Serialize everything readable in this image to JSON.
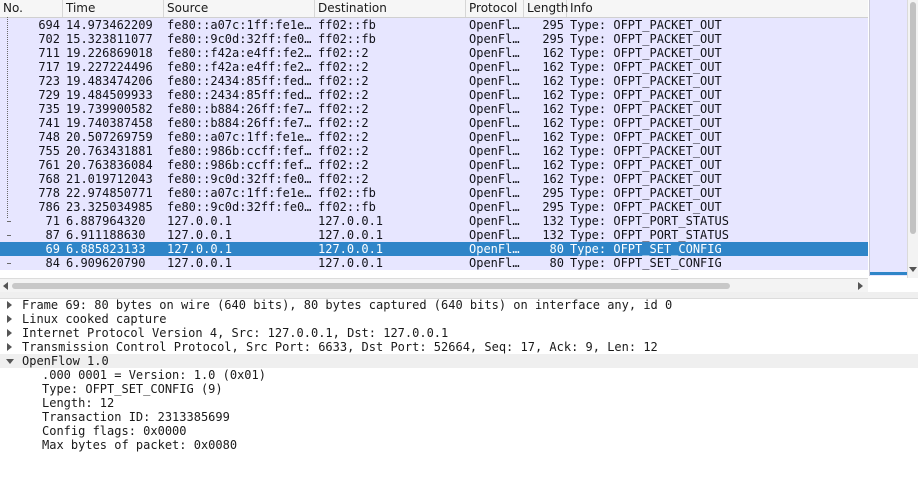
{
  "columns": {
    "no": "No.",
    "time": "Time",
    "source": "Source",
    "destination": "Destination",
    "protocol": "Protocol",
    "length": "Length",
    "info": "Info"
  },
  "packets": [
    {
      "no": "694",
      "time": "14.973462209",
      "source": "fe80::a07c:1ff:fe1e…",
      "destination": "ff02::fb",
      "protocol": "OpenFl…",
      "length": "295",
      "info": "Type: OFPT_PACKET_OUT",
      "selected": false
    },
    {
      "no": "702",
      "time": "15.323811077",
      "source": "fe80::9c0d:32ff:fe0…",
      "destination": "ff02::fb",
      "protocol": "OpenFl…",
      "length": "295",
      "info": "Type: OFPT_PACKET_OUT",
      "selected": false
    },
    {
      "no": "711",
      "time": "19.226869018",
      "source": "fe80::f42a:e4ff:fe2…",
      "destination": "ff02::2",
      "protocol": "OpenFl…",
      "length": "162",
      "info": "Type: OFPT_PACKET_OUT",
      "selected": false
    },
    {
      "no": "717",
      "time": "19.227224496",
      "source": "fe80::f42a:e4ff:fe2…",
      "destination": "ff02::2",
      "protocol": "OpenFl…",
      "length": "162",
      "info": "Type: OFPT_PACKET_OUT",
      "selected": false
    },
    {
      "no": "723",
      "time": "19.483474206",
      "source": "fe80::2434:85ff:fed…",
      "destination": "ff02::2",
      "protocol": "OpenFl…",
      "length": "162",
      "info": "Type: OFPT_PACKET_OUT",
      "selected": false
    },
    {
      "no": "729",
      "time": "19.484509933",
      "source": "fe80::2434:85ff:fed…",
      "destination": "ff02::2",
      "protocol": "OpenFl…",
      "length": "162",
      "info": "Type: OFPT_PACKET_OUT",
      "selected": false
    },
    {
      "no": "735",
      "time": "19.739900582",
      "source": "fe80::b884:26ff:fe7…",
      "destination": "ff02::2",
      "protocol": "OpenFl…",
      "length": "162",
      "info": "Type: OFPT_PACKET_OUT",
      "selected": false
    },
    {
      "no": "741",
      "time": "19.740387458",
      "source": "fe80::b884:26ff:fe7…",
      "destination": "ff02::2",
      "protocol": "OpenFl…",
      "length": "162",
      "info": "Type: OFPT_PACKET_OUT",
      "selected": false
    },
    {
      "no": "748",
      "time": "20.507269759",
      "source": "fe80::a07c:1ff:fe1e…",
      "destination": "ff02::2",
      "protocol": "OpenFl…",
      "length": "162",
      "info": "Type: OFPT_PACKET_OUT",
      "selected": false
    },
    {
      "no": "755",
      "time": "20.763431881",
      "source": "fe80::986b:ccff:fef…",
      "destination": "ff02::2",
      "protocol": "OpenFl…",
      "length": "162",
      "info": "Type: OFPT_PACKET_OUT",
      "selected": false
    },
    {
      "no": "761",
      "time": "20.763836084",
      "source": "fe80::986b:ccff:fef…",
      "destination": "ff02::2",
      "protocol": "OpenFl…",
      "length": "162",
      "info": "Type: OFPT_PACKET_OUT",
      "selected": false
    },
    {
      "no": "768",
      "time": "21.019712043",
      "source": "fe80::9c0d:32ff:fe0…",
      "destination": "ff02::2",
      "protocol": "OpenFl…",
      "length": "162",
      "info": "Type: OFPT_PACKET_OUT",
      "selected": false
    },
    {
      "no": "778",
      "time": "22.974850771",
      "source": "fe80::a07c:1ff:fe1e…",
      "destination": "ff02::fb",
      "protocol": "OpenFl…",
      "length": "295",
      "info": "Type: OFPT_PACKET_OUT",
      "selected": false
    },
    {
      "no": "786",
      "time": "23.325034985",
      "source": "fe80::9c0d:32ff:fe0…",
      "destination": "ff02::fb",
      "protocol": "OpenFl…",
      "length": "295",
      "info": "Type: OFPT_PACKET_OUT",
      "selected": false
    },
    {
      "no": "71",
      "time": "6.887964320",
      "source": "127.0.0.1",
      "destination": "127.0.0.1",
      "protocol": "OpenFl…",
      "length": "132",
      "info": "Type: OFPT_PORT_STATUS",
      "selected": false
    },
    {
      "no": "87",
      "time": "6.911188630",
      "source": "127.0.0.1",
      "destination": "127.0.0.1",
      "protocol": "OpenFl…",
      "length": "132",
      "info": "Type: OFPT_PORT_STATUS",
      "selected": false
    },
    {
      "no": "69",
      "time": "6.885823133",
      "source": "127.0.0.1",
      "destination": "127.0.0.1",
      "protocol": "OpenFl…",
      "length": "80",
      "info": "Type: OFPT_SET_CONFIG",
      "selected": true
    },
    {
      "no": "84",
      "time": "6.909620790",
      "source": "127.0.0.1",
      "destination": "127.0.0.1",
      "protocol": "OpenFl…",
      "length": "80",
      "info": "Type: OFPT_SET_CONFIG",
      "selected": false
    }
  ],
  "details": [
    {
      "text": "Frame 69: 80 bytes on wire (640 bits), 80 bytes captured (640 bits) on interface any, id 0",
      "state": "closed"
    },
    {
      "text": "Linux cooked capture",
      "state": "closed"
    },
    {
      "text": "Internet Protocol Version 4, Src: 127.0.0.1, Dst: 127.0.0.1",
      "state": "closed"
    },
    {
      "text": "Transmission Control Protocol, Src Port: 6633, Dst Port: 52664, Seq: 17, Ack: 9, Len: 12",
      "state": "closed"
    },
    {
      "text": "OpenFlow 1.0",
      "state": "open"
    },
    {
      "text": ".000 0001 = Version: 1.0 (0x01)",
      "state": "child"
    },
    {
      "text": "Type: OFPT_SET_CONFIG (9)",
      "state": "child"
    },
    {
      "text": "Length: 12",
      "state": "child"
    },
    {
      "text": "Transaction ID: 2313385699",
      "state": "child"
    },
    {
      "text": "Config flags: 0x0000",
      "state": "child"
    },
    {
      "text": "Max bytes of packet: 0x0080",
      "state": "child"
    }
  ],
  "colors": {
    "row_background": "#e7e6ff",
    "selected_row": "#2f85c8"
  },
  "icons": {
    "collapsed": "triangle-right-icon",
    "expanded": "triangle-down-icon"
  }
}
